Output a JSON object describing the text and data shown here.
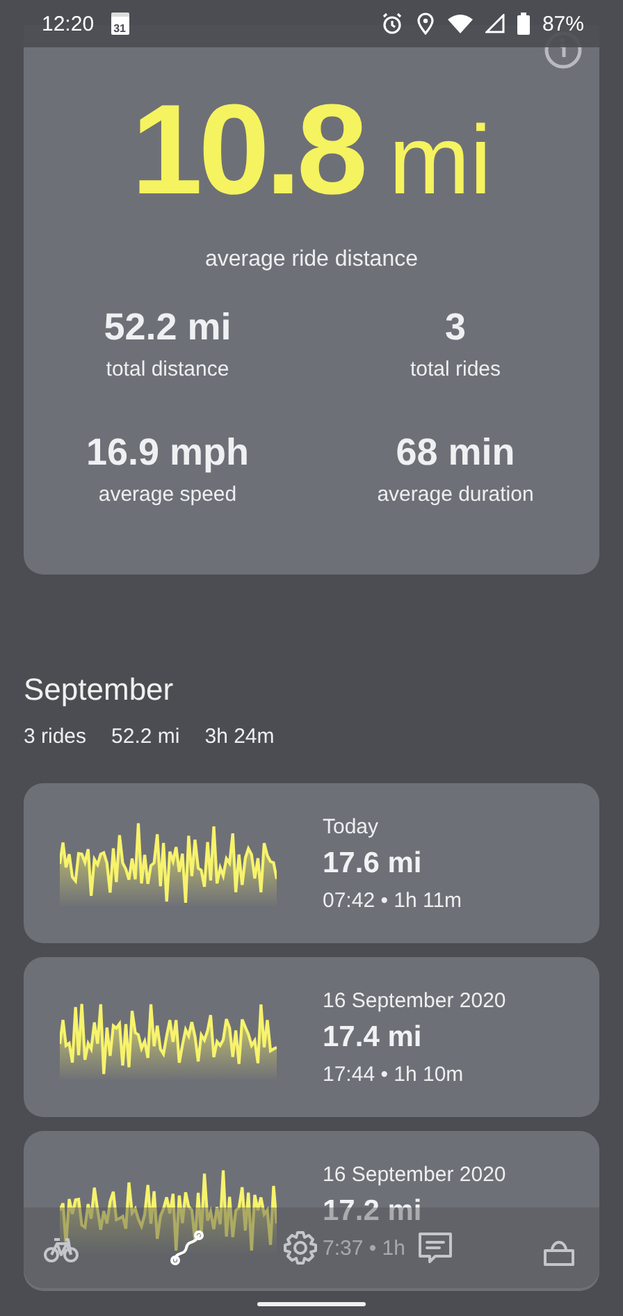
{
  "status_bar": {
    "time": "12:20",
    "calendar_day": "31",
    "battery": "87%"
  },
  "summary_card": {
    "headline_value": "10.8",
    "headline_unit": "mi",
    "headline_label": "average ride distance",
    "stats": [
      {
        "value": "52.2 mi",
        "label": "total distance"
      },
      {
        "value": "3",
        "label": "total rides"
      },
      {
        "value": "16.9 mph",
        "label": "average speed"
      },
      {
        "value": "68 min",
        "label": "average duration"
      }
    ]
  },
  "month": {
    "title": "September",
    "totals": [
      "3 rides",
      "52.2 mi",
      "3h 24m"
    ]
  },
  "rides": [
    {
      "date": "Today",
      "distance": "17.6 mi",
      "details": "07:42 • 1h 11m"
    },
    {
      "date": "16 September 2020",
      "distance": "17.4 mi",
      "details": "17:44 • 1h 10m"
    },
    {
      "date": "16 September 2020",
      "distance": "17.2 mi",
      "details": "7:37 • 1h"
    }
  ],
  "bottom_nav": [
    {
      "kind": "bike",
      "selected": false
    },
    {
      "kind": "route",
      "selected": true
    },
    {
      "kind": "settings",
      "selected": false
    },
    {
      "kind": "chat",
      "selected": false
    },
    {
      "kind": "profile",
      "selected": false
    }
  ]
}
